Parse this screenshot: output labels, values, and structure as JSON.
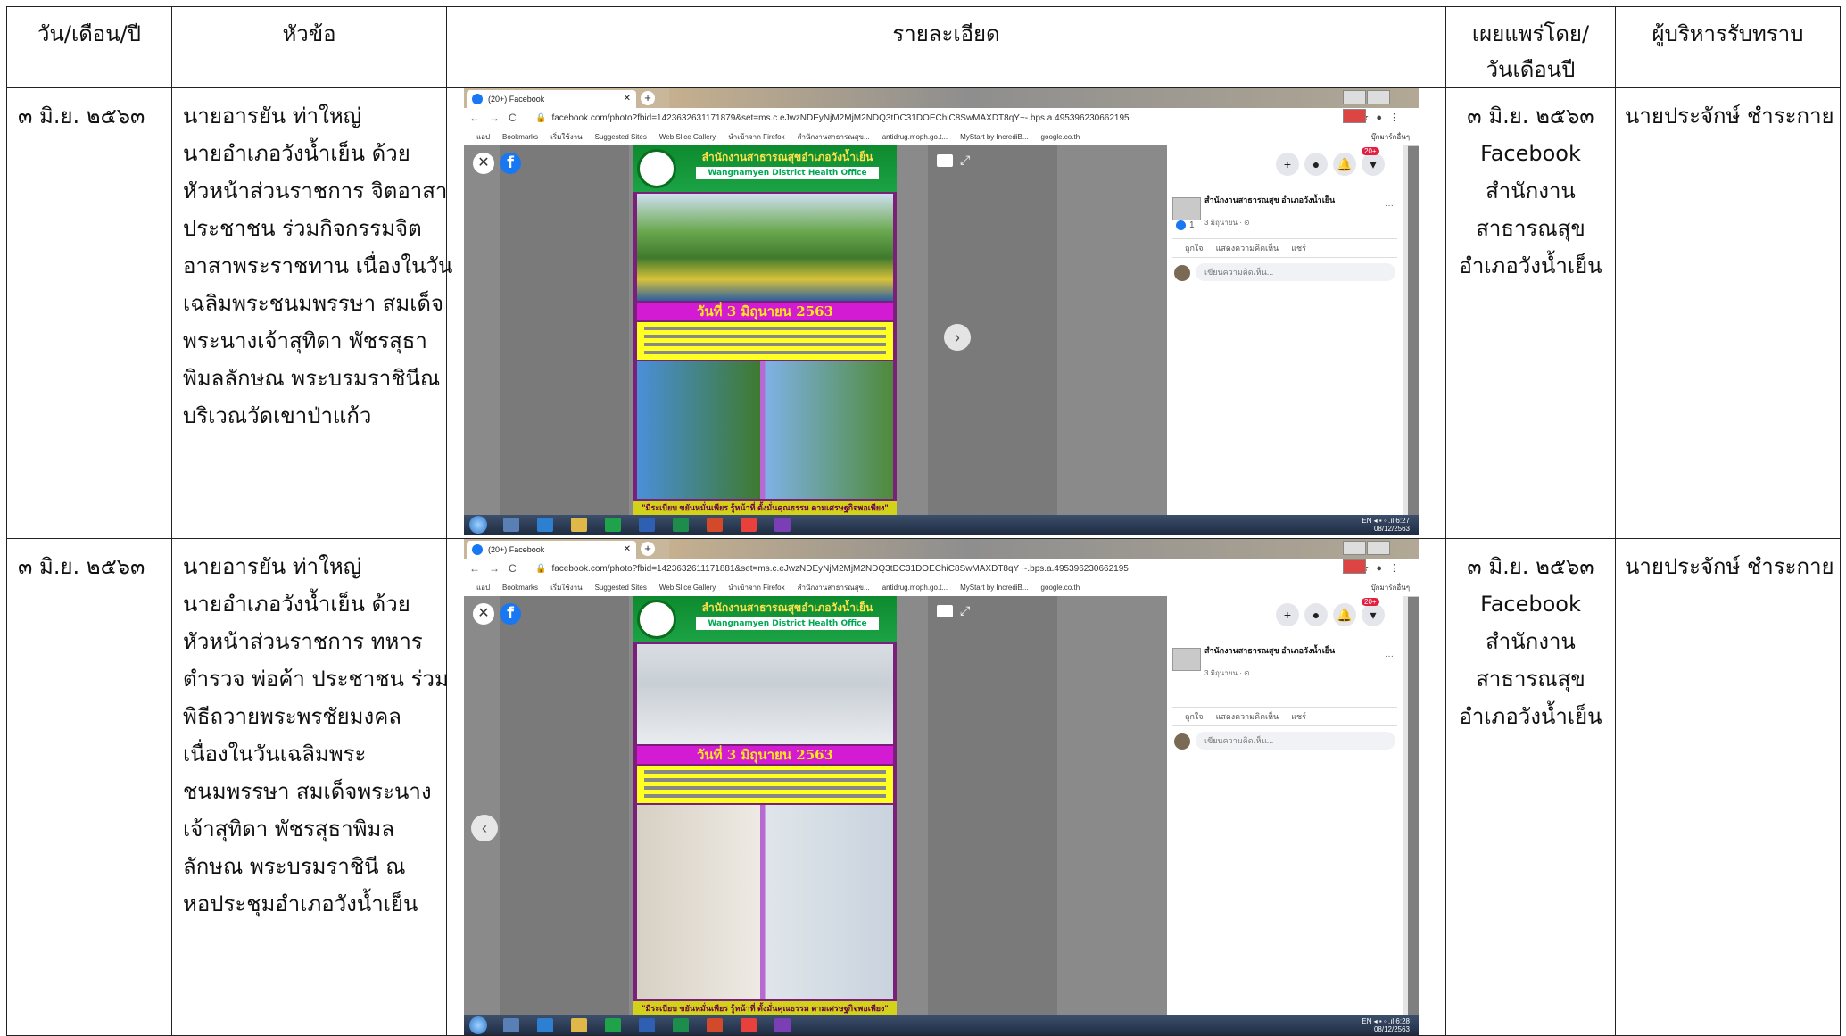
{
  "header": {
    "date": "วัน/เดือน/ปี",
    "topic": "หัวข้อ",
    "detail": "รายละเอียด",
    "published": [
      "เผยแพร่โดย/",
      "วันเดือนปี"
    ],
    "acknowledged": "ผู้บริหารรับทราบ"
  },
  "rows": [
    {
      "date": "๓ มิ.ย. ๒๕๖๓",
      "topic_lines": [
        "นายอารยัน  ท่าใหญ่",
        "นายอำเภอวังน้ำเย็น ด้วย",
        "หัวหน้าส่วนราชการ จิตอาสา",
        "ประชาชน ร่วมกิจกรรมจิต",
        "อาสาพระราชทาน เนื่องในวัน",
        "เฉลิมพระชนมพรรษา  สมเด็จ",
        "พระนางเจ้าสุทิดา พัชรสุธา",
        "พิมลลักษณ พระบรมราชินีณ",
        "บริเวณวัดเขาป่าแก้ว"
      ],
      "published_lines": [
        "๓ มิ.ย. ๒๕๖๓",
        "Facebook",
        "สำนักงาน",
        "สาธารณสุข",
        "อำเภอวังน้ำเย็น"
      ],
      "acknowledged": "นายประจักษ์  ชำระกาย",
      "screenshot": {
        "tab_title": "(20+) Facebook",
        "url": "facebook.com/photo?fbid=1423632631171879&set=ms.c.eJwzNDEyNjM2MjM2NDQ3tDC31DOEChiC8SwMAXDT8qY~-.bps.a.495396230662195",
        "bookmarks": [
          "แอป",
          "Bookmarks",
          "เริ่มใช้งาน",
          "Suggested Sites",
          "Web Slice Gallery",
          "นำเข้าจาก Firefox",
          "สำนักงานสาธารณสุข...",
          "antidrug.moph.go.t...",
          "MyStart by IncrediB...",
          "google.co.th",
          "บุ๊กมาร์กอื่นๆ"
        ],
        "poster_title": "สำนักงานสาธารณสุขอำเภอวังน้ำเย็น",
        "poster_subtitle": "Wangnamyen District Health Office",
        "poster_date": "วันที่  3  มิถุนายน 2563",
        "poster_footer": "\"มีระเบียบ  ขยันหมั่นเพียร  รู้หน้าที่  ตั้งมั่นคุณธรรม  ตามเศรษฐกิจพอเพียง\"",
        "page_name": "สำนักงานสาธารณสุข อำเภอวังน้ำเย็น",
        "post_date": "3 มิถุนายน · ⊙",
        "like_count": "1",
        "like_label": "ถูกใจ",
        "comment_label": "แสดงความคิดเห็น",
        "share_label": "แชร์",
        "comment_placeholder": "เขียนความคิดเห็น...",
        "notif_badge": "20+",
        "lang": "EN",
        "time": "6:27",
        "clock_date": "08/12/2563"
      }
    },
    {
      "date": "๓ มิ.ย. ๒๕๖๓",
      "topic_lines": [
        " นายอารยัน  ท่าใหญ่",
        "นายอำเภอวังน้ำเย็น ด้วย",
        "หัวหน้าส่วนราชการ ทหาร",
        "ตำรวจ พ่อค้า ประชาชน ร่วม",
        "พิธีถวายพระพรชัยมงคล",
        "เนื่องในวันเฉลิมพระ",
        "ชนมพรรษา  สมเด็จพระนาง",
        "เจ้าสุทิดา พัชรสุธาพิมล",
        "ลักษณ พระบรมราชินี ณ",
        "หอประชุมอำเภอวังน้ำเย็น"
      ],
      "published_lines": [
        "๓ มิ.ย. ๒๕๖๓",
        "Facebook",
        "สำนักงาน",
        "สาธารณสุข",
        "อำเภอวังน้ำเย็น"
      ],
      "acknowledged": "นายประจักษ์  ชำระกาย",
      "screenshot": {
        "tab_title": "(20+) Facebook",
        "url": "facebook.com/photo?fbid=1423632611171881&set=ms.c.eJwzNDEyNjM2MjM2NDQ3tDC31DOEChiC8SwMAXDT8qY~-.bps.a.495396230662195",
        "bookmarks": [
          "แอป",
          "Bookmarks",
          "เริ่มใช้งาน",
          "Suggested Sites",
          "Web Slice Gallery",
          "นำเข้าจาก Firefox",
          "สำนักงานสาธารณสุข...",
          "antidrug.moph.go.t...",
          "MyStart by IncrediB...",
          "google.co.th",
          "บุ๊กมาร์กอื่นๆ"
        ],
        "poster_title": "สำนักงานสาธารณสุขอำเภอวังน้ำเย็น",
        "poster_subtitle": "Wangnamyen District Health Office",
        "poster_date": "วันที่  3  มิถุนายน 2563",
        "poster_footer": "\"มีระเบียบ  ขยันหมั่นเพียร  รู้หน้าที่  ตั้งมั่นคุณธรรม  ตามเศรษฐกิจพอเพียง\"",
        "page_name": "สำนักงานสาธารณสุข อำเภอวังน้ำเย็น",
        "post_date": "3 มิถุนายน · ⊙",
        "like_label": "ถูกใจ",
        "comment_label": "แสดงความคิดเห็น",
        "share_label": "แชร์",
        "comment_placeholder": "เขียนความคิดเห็น...",
        "notif_badge": "20+",
        "lang": "EN",
        "time": "6:28",
        "clock_date": "08/12/2563"
      }
    }
  ]
}
